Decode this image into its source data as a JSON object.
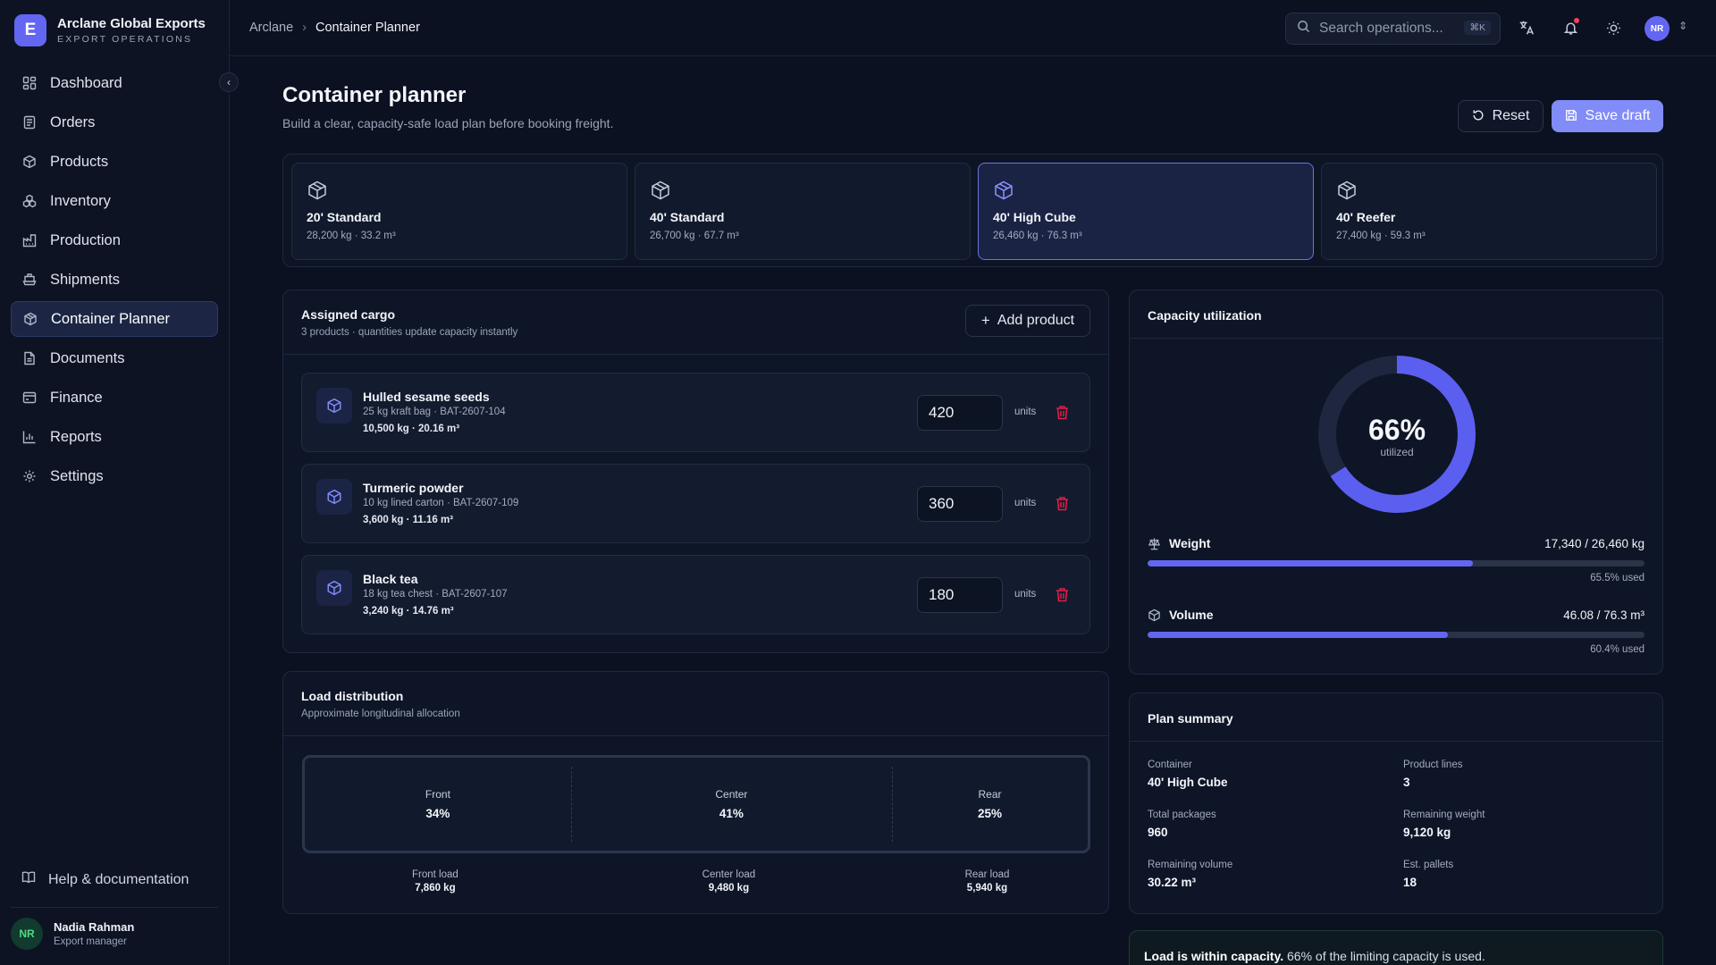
{
  "brand": {
    "logo_letter": "E",
    "name": "Arclane Global Exports",
    "subtitle": "EXPORT OPERATIONS"
  },
  "nav": {
    "items": [
      {
        "label": "Dashboard",
        "icon": "dashboard-icon"
      },
      {
        "label": "Orders",
        "icon": "orders-icon"
      },
      {
        "label": "Products",
        "icon": "products-icon"
      },
      {
        "label": "Inventory",
        "icon": "inventory-icon"
      },
      {
        "label": "Production",
        "icon": "production-icon"
      },
      {
        "label": "Shipments",
        "icon": "shipments-icon"
      },
      {
        "label": "Container Planner",
        "icon": "container-icon",
        "active": true
      },
      {
        "label": "Documents",
        "icon": "documents-icon"
      },
      {
        "label": "Finance",
        "icon": "finance-icon"
      },
      {
        "label": "Reports",
        "icon": "reports-icon"
      },
      {
        "label": "Settings",
        "icon": "settings-icon"
      }
    ],
    "help_label": "Help & documentation"
  },
  "user": {
    "initials": "NR",
    "name": "Nadia Rahman",
    "role": "Export manager"
  },
  "topbar": {
    "breadcrumb": [
      "Arclane",
      "Container Planner"
    ],
    "search_placeholder": "Search operations...",
    "search_shortcut": "⌘K",
    "avatar_initials": "NR"
  },
  "page": {
    "title": "Container planner",
    "subtitle": "Build a clear, capacity-safe load plan before booking freight.",
    "reset_label": "Reset",
    "save_label": "Save draft"
  },
  "containers": [
    {
      "name": "20' Standard",
      "spec": "28,200 kg · 33.2 m³",
      "selected": false
    },
    {
      "name": "40' Standard",
      "spec": "26,700 kg · 67.7 m³",
      "selected": false
    },
    {
      "name": "40' High Cube",
      "spec": "26,460 kg · 76.3 m³",
      "selected": true
    },
    {
      "name": "40' Reefer",
      "spec": "27,400 kg · 59.3 m³",
      "selected": false
    }
  ],
  "cargo": {
    "title": "Assigned cargo",
    "subtitle": "3 products · quantities update capacity instantly",
    "add_label": "Add product",
    "units_label": "units",
    "items": [
      {
        "name": "Hulled sesame seeds",
        "meta": "25 kg kraft bag · BAT-2607-104",
        "totals": "10,500 kg · 20.16 m³",
        "qty": "420"
      },
      {
        "name": "Turmeric powder",
        "meta": "10 kg lined carton · BAT-2607-109",
        "totals": "3,600 kg · 11.16 m³",
        "qty": "360"
      },
      {
        "name": "Black tea",
        "meta": "18 kg tea chest · BAT-2607-107",
        "totals": "3,240 kg · 14.76 m³",
        "qty": "180"
      }
    ]
  },
  "distribution": {
    "title": "Load distribution",
    "subtitle": "Approximate longitudinal allocation",
    "zones": [
      {
        "label": "Front",
        "pct": "34%",
        "share": 34
      },
      {
        "label": "Center",
        "pct": "41%",
        "share": 41
      },
      {
        "label": "Rear",
        "pct": "25%",
        "share": 25
      }
    ],
    "loads": [
      {
        "label": "Front load",
        "value": "7,860 kg"
      },
      {
        "label": "Center load",
        "value": "9,480 kg"
      },
      {
        "label": "Rear load",
        "value": "5,940 kg"
      }
    ]
  },
  "capacity": {
    "title": "Capacity utilization",
    "percent_label": "66%",
    "percent": 66,
    "utilized_label": "utilized",
    "weight": {
      "label": "Weight",
      "value": "17,340 / 26,460 kg",
      "fraction": 0.655,
      "used": "65.5% used"
    },
    "volume": {
      "label": "Volume",
      "value": "46.08 / 76.3 m³",
      "fraction": 0.604,
      "used": "60.4% used"
    }
  },
  "summary": {
    "title": "Plan summary",
    "cells": [
      {
        "key": "Container",
        "value": "40' High Cube"
      },
      {
        "key": "Product lines",
        "value": "3"
      },
      {
        "key": "Total packages",
        "value": "960"
      },
      {
        "key": "Remaining weight",
        "value": "9,120 kg"
      },
      {
        "key": "Remaining volume",
        "value": "30.22 m³"
      },
      {
        "key": "Est. pallets",
        "value": "18"
      }
    ]
  },
  "status": {
    "bold": "Load is within capacity.",
    "text": " 66% of the limiting capacity is used."
  },
  "colors": {
    "accent": "#6366f1",
    "accent_light": "#818cf8",
    "danger": "#e11d48",
    "success": "#4ade80"
  }
}
